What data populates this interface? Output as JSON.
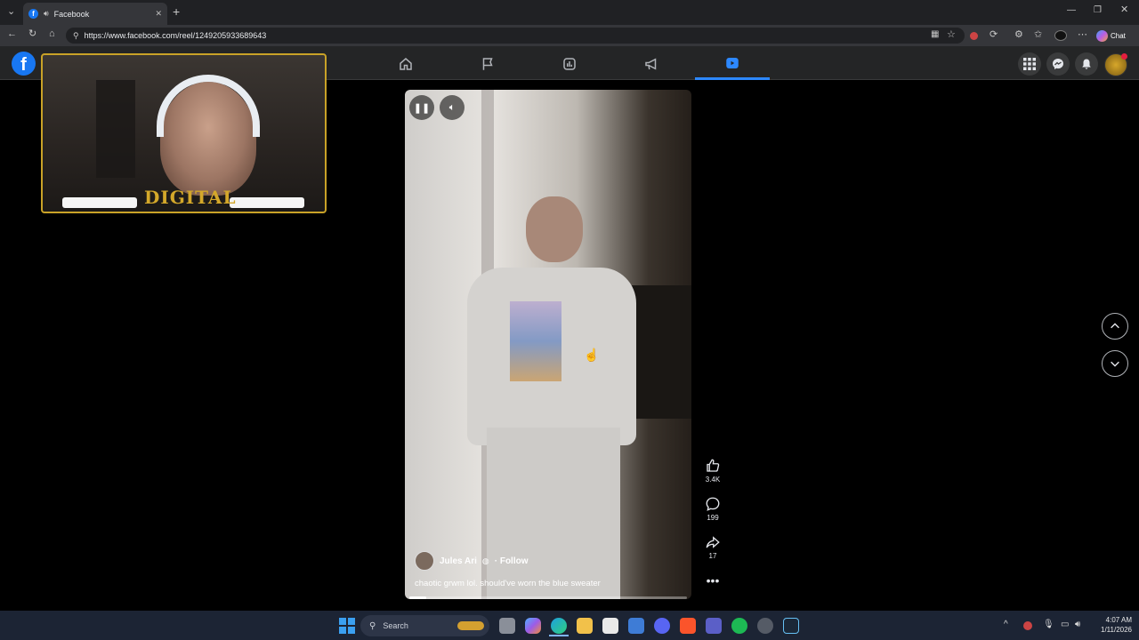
{
  "browser": {
    "tab_title": "Facebook",
    "tab_close": "✕",
    "new_tab": "+",
    "url": "https://www.facebook.com/reel/1249205933689643",
    "chat_label": "Chat"
  },
  "fb": {
    "logo_letter": "f",
    "nav_tabs": [
      "home",
      "pages",
      "dashboard",
      "advertise",
      "reels"
    ],
    "active_tab": "reels"
  },
  "webcam": {
    "overlay_text": "DIGITAL"
  },
  "reel": {
    "author": "Jules Ari",
    "follow_label": "· Follow",
    "caption": "chaotic grwm lol. should've worn the blue sweater",
    "progress": 0.06,
    "pause_icon": "pause-icon",
    "volume_icon": "volume-icon"
  },
  "actions": {
    "likes": "3.4K",
    "comments": "199",
    "shares": "17"
  },
  "taskbar": {
    "search_label": "Search",
    "time": "4:07 AM",
    "date": "1/11/2026"
  },
  "colors": {
    "accent": "#2d88ff",
    "fb_blue": "#1877f2",
    "webcam_border": "#c9a227"
  }
}
